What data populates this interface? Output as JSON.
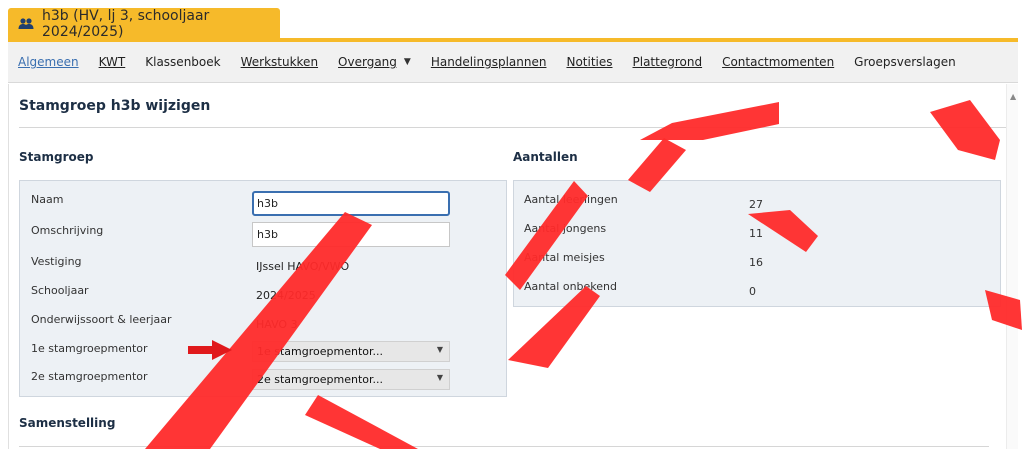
{
  "window_tab": {
    "title": "h3b (HV, lj 3, schooljaar 2024/2025)",
    "icon": "group-icon"
  },
  "nav": {
    "items": [
      {
        "label": "Algemeen",
        "active": true
      },
      {
        "label": "KWT"
      },
      {
        "label": "Klassenboek"
      },
      {
        "label": "Werkstukken"
      },
      {
        "label": "Overgang",
        "has_dropdown": true
      },
      {
        "label": "Handelingsplannen"
      },
      {
        "label": "Notities"
      },
      {
        "label": "Plattegrond"
      },
      {
        "label": "Contactmomenten"
      },
      {
        "label": "Groepsverslagen"
      }
    ]
  },
  "page": {
    "title": "Stamgroep h3b wijzigen"
  },
  "stamgroep": {
    "section_title": "Stamgroep",
    "fields": {
      "naam_label": "Naam",
      "naam_value": "h3b",
      "omschrijving_label": "Omschrijving",
      "omschrijving_value": "h3b",
      "vestiging_label": "Vestiging",
      "vestiging_value": "IJssel HAVO/VWO",
      "schooljaar_label": "Schooljaar",
      "schooljaar_value": "2024/2025",
      "onderwijssoort_label": "Onderwijssoort & leerjaar",
      "onderwijssoort_value": "HAVO 3",
      "mentor1_label": "1e stamgroepmentor",
      "mentor1_value": "1e stamgroepmentor...",
      "mentor2_label": "2e stamgroepmentor",
      "mentor2_value": "2e stamgroepmentor..."
    }
  },
  "aantallen": {
    "section_title": "Aantallen",
    "rows": [
      {
        "label": "Aantal leerlingen",
        "value": "27"
      },
      {
        "label": "Aantal jongens",
        "value": "11"
      },
      {
        "label": "Aantal meisjes",
        "value": "16"
      },
      {
        "label": "Aantal onbekend",
        "value": "0"
      }
    ]
  },
  "samenstelling": {
    "section_title": "Samenstelling"
  },
  "watermark": {
    "text": "TEST",
    "color": "#ff2a2a"
  },
  "annotation": {
    "arrow_color": "#e0191c"
  },
  "colors": {
    "accent": "#f6ba2a",
    "link_active": "#3a6fb0",
    "panel_bg": "#edf1f5"
  }
}
